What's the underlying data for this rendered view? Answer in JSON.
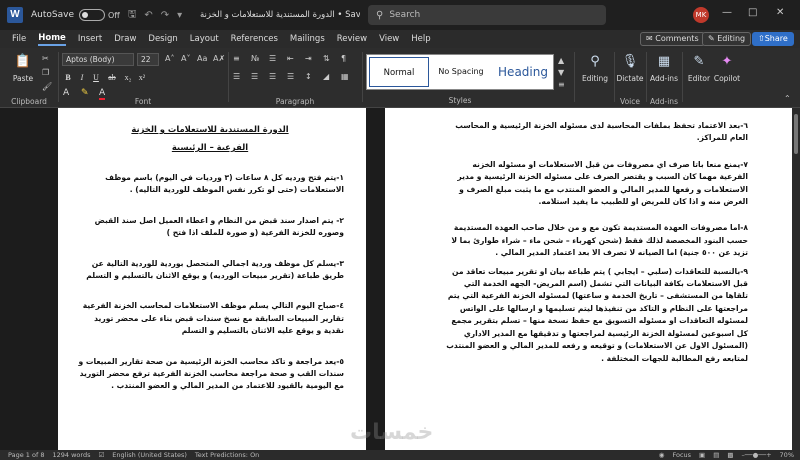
{
  "titlebar": {
    "app_letter": "W",
    "autosave_label": "AutoSave",
    "autosave_state": "Off",
    "doc_title": "الدورة المستندية للاستعلامات و الخزنة • Saved",
    "search_placeholder": "Search",
    "user_initials": "MK"
  },
  "menu": {
    "tabs": [
      "File",
      "Home",
      "Insert",
      "Draw",
      "Design",
      "Layout",
      "References",
      "Mailings",
      "Review",
      "View",
      "Help"
    ],
    "active": "Home",
    "comments_label": "Comments",
    "editing_label": "Editing",
    "share_label": "Share"
  },
  "ribbon": {
    "paste_label": "Paste",
    "clipboard_label": "Clipboard",
    "font_name": "Aptos (Body)",
    "font_size": "22",
    "font_label": "Font",
    "paragraph_label": "Paragraph",
    "styles": [
      "Normal",
      "No Spacing",
      "Heading"
    ],
    "styles_label": "Styles",
    "editing_label": "Editing",
    "dictate_label": "Dictate",
    "voice_label": "Voice",
    "addins_label": "Add-ins",
    "addins_group_label": "Add-ins",
    "editor_label": "Editor",
    "copilot_label": "Copilot"
  },
  "doc": {
    "left_page": {
      "title_line1": "الدورة المستندية للاستعلامات و الخزنة",
      "title_line2": "الفرعية – الرئيسية",
      "paragraphs": [
        "١-يتم فتح ورديه كل ٨ ساعات (٣ ورديات في اليوم) باسم موظف الاستعلامات (حتى لو تكرر نفس الموظف للوردية التاليه) .",
        "٢- يتم اصدار سند قبض من النظام و اعطاء العميل اصل سند القبض وصوره للخزنة الفرعية (و صورة للملف اذا فتح )",
        "٣-يسلم كل موظف وردية اجمالي المتحصل بوردية للوردية التالية عن طريق طباعة (تقرير مبيعات الورديه) و يوقع الاثنان بالتسليم و التسلم",
        "٤-صباح اليوم التالي يسلم موظف الاستعلامات لمحاسب الخزنة الفرعية تقارير المبيعات السابقة مع نسخ سندات قبض بناء على محضر توريد نقدية و يوقع عليه الاثنان بالتسليم و التسلم",
        "٥-يعد مراجعة و تاكد محاسب الخزنة الرئيسية من صحة تقارير المبيعات و سندات القب و صحة مراجعة محاسب الخزنة الفرعية ترفع محضر التوريد مع اليومية بالقيود للاعتماد من المدير المالي و العضو المنتدب ."
      ]
    },
    "right_page": {
      "paragraphs": [
        "٦-بعد الاعتماد تحفظ بملفات المحاسبة لدى مسئوله الخزنة الرئيسية و المحاسب العام للمراكز.",
        "٧-يمنع منعا باتا صرف اي مصروفات من قبل الاستعلامات او مسئوله الخزنه الفرعية مهما كان السبب و يقتصر الصرف على مسئوله الخزنة الرئيسية و مدير الاستعلامات و رفعها للمدير المالي و العضو المنتدب مع ما يثبت مبلغ الصرف و الغرض منه و اذا كان للمريض او للطبيب ما يفيد استلامه.",
        "٨-اما مصروفات العهدة المستديمة تكون مع و من خلال صاحب العهدة المستديمة حسب البنود المخصصة لذلك فقط (شحن كهرباء – شحن ماء – شراء طوارئ بما لا تزيد عن ٥٠٠ جنية) اما الصيانه لا تصرف الا بعد اعتماد المدير المالي .",
        "٩-بالنسبة للتعاقدات (سلبي – ايجابي ) يتم طباعة بيان او تقرير مبيعات تعاقد من قبل الاستعلامات بكافة البيانات التي تشمل (اسم المريض- الجهه الخدمة التي تلقاها من المستشفى – تاريخ الخدمة و ساعتها) لمسئوله الخزنة الفرعية التي يتم مراجعتها على النظام و التاكد من تنفيذها ليتم تسليمها و ارسالها على الواتس لمسئوله التعاقدات او مسئوله التسويق مع حفظ نسخة منها – تسلم بتقرير مجمع كل اسبوعين لمسئولة الخزنة الرئيسية لمراجعتها و تدقيقها مع المدير الاداري (المسئول الاول عن الاستعلامات) و توقيعه و رفعه للمدير المالي و العضو المنتدب لمتابعه رفع المطالبة للجهات المختلفة ."
      ]
    }
  },
  "status": {
    "page": "Page 1 of 8",
    "words": "1294 words",
    "language": "English (United States)",
    "text_predictions": "Text Predictions: On",
    "focus_label": "Focus",
    "zoom": "70%"
  },
  "watermark_text": "خمسات"
}
